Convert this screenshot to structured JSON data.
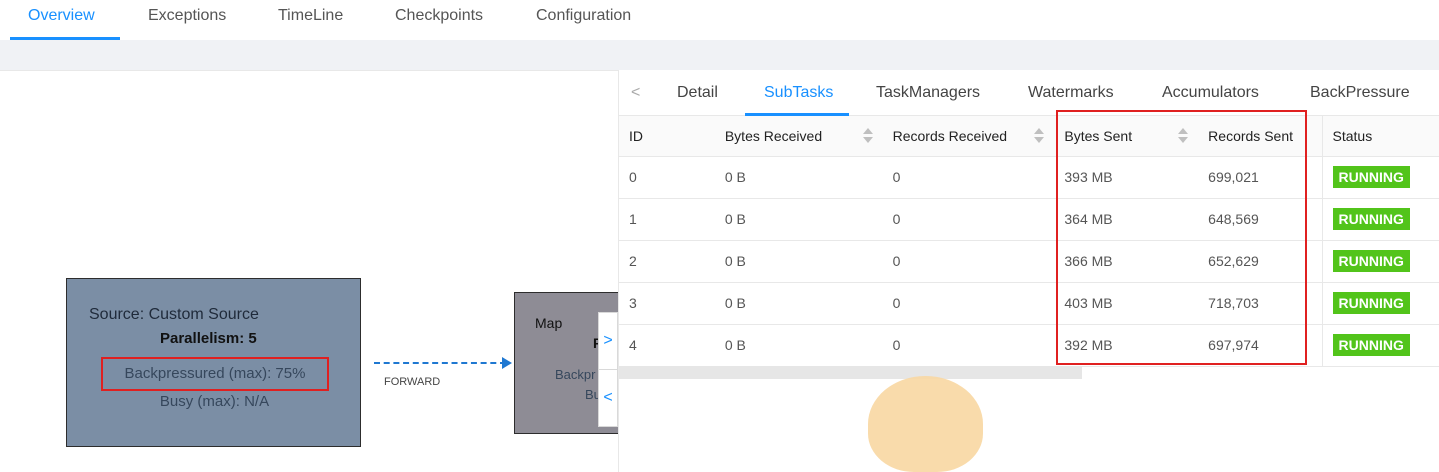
{
  "top_tabs": [
    "Overview",
    "Exceptions",
    "TimeLine",
    "Checkpoints",
    "Configuration"
  ],
  "active_top_tab": "Overview",
  "graph": {
    "source_node": {
      "title": "Source: Custom Source",
      "parallelism": "Parallelism: 5",
      "backpressure": "Backpressured (max): 75%",
      "busy": "Busy (max): N/A"
    },
    "edge_label": "FORWARD",
    "map_node": {
      "title": "Map",
      "parallelism_fragment": "F",
      "backpressure_fragment": "Backpr",
      "busy_fragment": "Bu"
    },
    "scroll_right_glyph": ">",
    "scroll_left_glyph": "<"
  },
  "sub_tabs": {
    "prev_glyph": "<",
    "items": [
      "Detail",
      "SubTasks",
      "TaskManagers",
      "Watermarks",
      "Accumulators",
      "BackPressure"
    ],
    "active": "SubTasks"
  },
  "table": {
    "columns": [
      "ID",
      "Bytes Received",
      "Records Received",
      "Bytes Sent",
      "Records Sent",
      "Status"
    ],
    "rows": [
      {
        "id": "0",
        "bytes_received": "0 B",
        "records_received": "0",
        "bytes_sent": "393 MB",
        "records_sent": "699,021",
        "status": "RUNNING"
      },
      {
        "id": "1",
        "bytes_received": "0 B",
        "records_received": "0",
        "bytes_sent": "364 MB",
        "records_sent": "648,569",
        "status": "RUNNING"
      },
      {
        "id": "2",
        "bytes_received": "0 B",
        "records_received": "0",
        "bytes_sent": "366 MB",
        "records_sent": "652,629",
        "status": "RUNNING"
      },
      {
        "id": "3",
        "bytes_received": "0 B",
        "records_received": "0",
        "bytes_sent": "403 MB",
        "records_sent": "718,703",
        "status": "RUNNING"
      },
      {
        "id": "4",
        "bytes_received": "0 B",
        "records_received": "0",
        "bytes_sent": "392 MB",
        "records_sent": "697,974",
        "status": "RUNNING"
      }
    ]
  },
  "colors": {
    "accent": "#1890ff",
    "running": "#52c41a",
    "highlight": "#e02020",
    "source_node_bg": "#7b8ea5",
    "map_node_bg": "#8e8c95"
  }
}
